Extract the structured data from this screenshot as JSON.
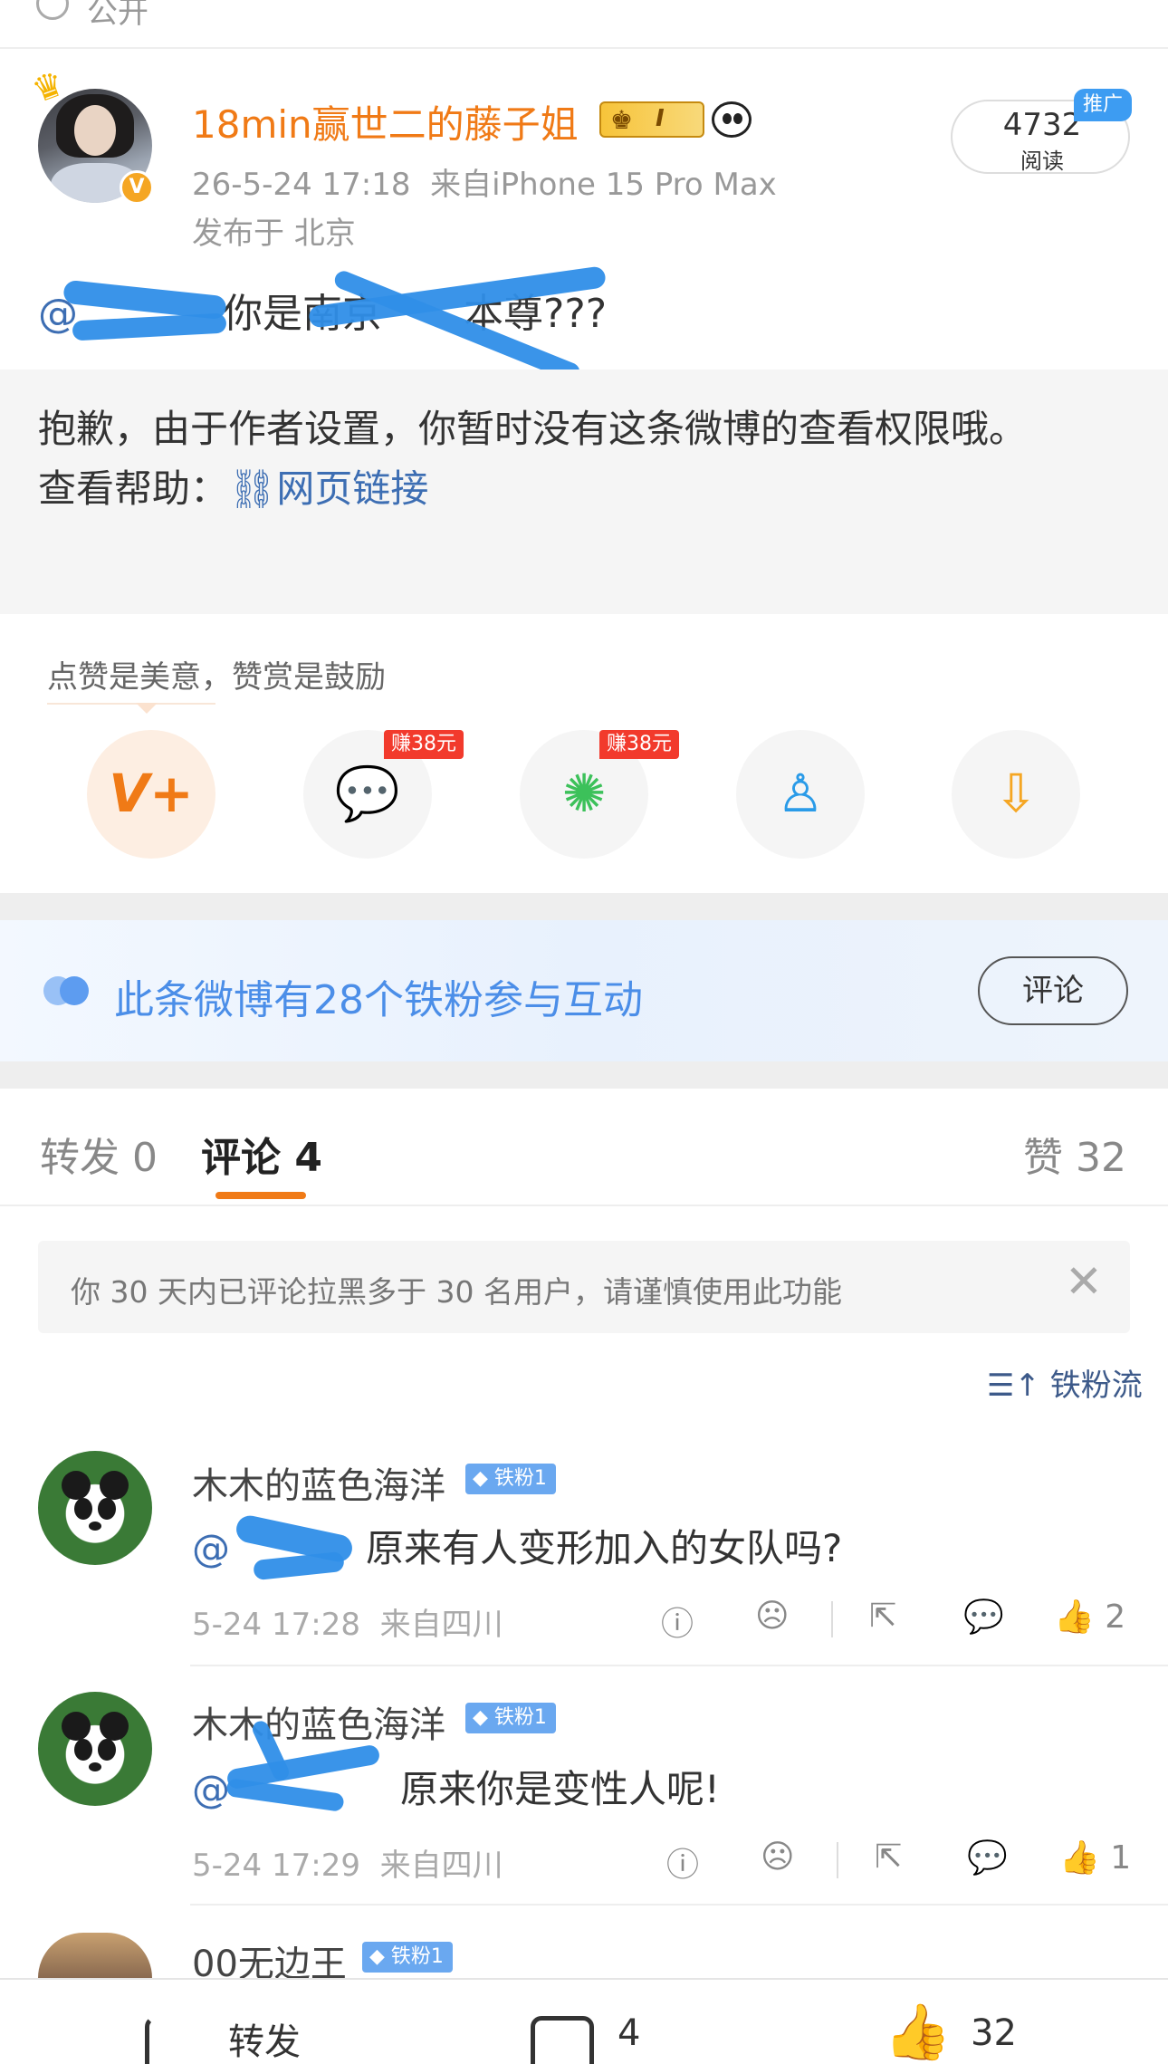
{
  "top": {
    "visibility": "公开"
  },
  "post": {
    "username": "18min赢世二的藤子姐",
    "member_badge_text": "I",
    "time": "26-5-24 17:18",
    "source": "来自iPhone 15 Pro Max",
    "location": "发布于 北京",
    "read_count": "4732",
    "read_label": "阅读",
    "promo_tag": "推广",
    "text_mention": "@",
    "text_body": "你是南京",
    "text_tail": "本尊???",
    "restricted_msg": "抱歉，由于作者设置，你暂时没有这条微博的查看权限哦。",
    "help_label": "查看帮助：",
    "help_link": "网页链接"
  },
  "reward": {
    "tip": "点赞是美意，赞赏是鼓励",
    "earn_wechat": "赚38元",
    "earn_moments": "赚38元",
    "icons": [
      "v-plus-icon",
      "wechat-icon",
      "moments-icon",
      "qq-icon",
      "save-image-icon"
    ]
  },
  "fans": {
    "text": "此条微博有28个铁粉参与互动",
    "button": "评论"
  },
  "tabs": {
    "repost": "转发 0",
    "comment": "评论 4",
    "like": "赞 32"
  },
  "warning": {
    "text": "你 30 天内已评论拉黑多于 30 名用户，请谨慎使用此功能"
  },
  "sort": {
    "label": "铁粉流"
  },
  "comments": [
    {
      "name": "木木的蓝色海洋",
      "badge": "铁粉1",
      "mention": "@",
      "text": "原来有人变形加入的女队吗?",
      "time": "5-24 17:28",
      "source": "来自四川",
      "likes": "2"
    },
    {
      "name": "木木的蓝色海洋",
      "badge": "铁粉1",
      "mention": "@",
      "text": "原来你是变性人呢!",
      "time": "5-24 17:29",
      "source": "来自四川",
      "likes": "1"
    },
    {
      "name": "00无边王",
      "badge": "铁粉1"
    }
  ],
  "bottom": {
    "repost": "转发",
    "comment_count": "4",
    "like_count": "32"
  },
  "colors": {
    "accent_orange": "#f07a16",
    "link_blue": "#3d6eb3",
    "fan_blue": "#4b8ee8",
    "earn_red": "#f23a2c"
  }
}
